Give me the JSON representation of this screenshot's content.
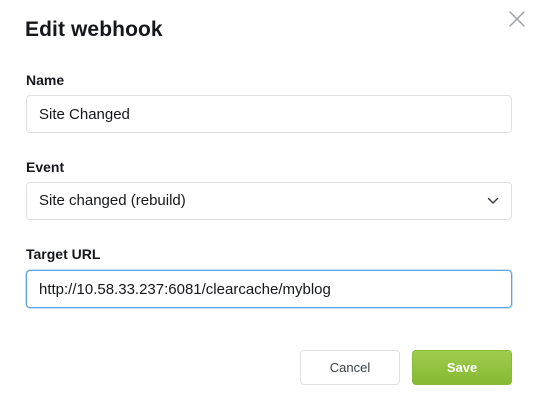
{
  "dialog": {
    "title": "Edit webhook",
    "close_icon": "close-icon"
  },
  "form": {
    "name": {
      "label": "Name",
      "value": "Site Changed"
    },
    "event": {
      "label": "Event",
      "selected": "Site changed (rebuild)",
      "icon": "chevron-down-icon"
    },
    "target_url": {
      "label": "Target URL",
      "value": "http://10.58.33.237:6081/clearcache/myblog"
    }
  },
  "actions": {
    "cancel_label": "Cancel",
    "save_label": "Save"
  },
  "colors": {
    "save_button": "#94c43f",
    "focus_border": "#5ba4e5",
    "field_border": "#dfe1e3"
  }
}
